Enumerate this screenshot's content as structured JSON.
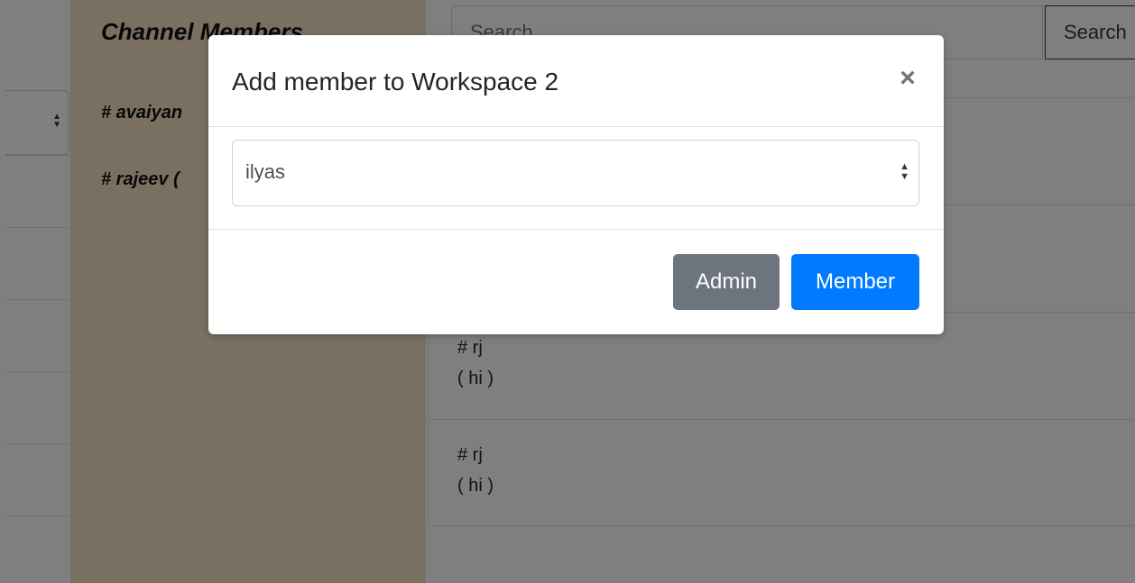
{
  "background": {
    "members_panel": {
      "title": "Channel Members",
      "members": [
        "# avaiyan",
        "# rajeev ("
      ]
    },
    "search": {
      "placeholder": "Search",
      "button_label": "Search"
    },
    "messages": [
      {
        "name": "",
        "text": ""
      },
      {
        "name": "",
        "text": ""
      },
      {
        "name": "# rj",
        "text": "( hi )"
      },
      {
        "name": "# rj",
        "text": "( hi )"
      }
    ]
  },
  "modal": {
    "title": "Add member to Workspace 2",
    "close_glyph": "×",
    "select": {
      "selected_value": "ilyas"
    },
    "buttons": {
      "admin_label": "Admin",
      "member_label": "Member"
    }
  },
  "colors": {
    "members_panel_bg": "#f5e1c2",
    "admin_button": "#6c757d",
    "member_button": "#007bff",
    "backdrop": "rgba(0,0,0,0.5)"
  },
  "icons": {
    "select_arrows": "up-down-caret-icon",
    "close": "close-icon"
  }
}
